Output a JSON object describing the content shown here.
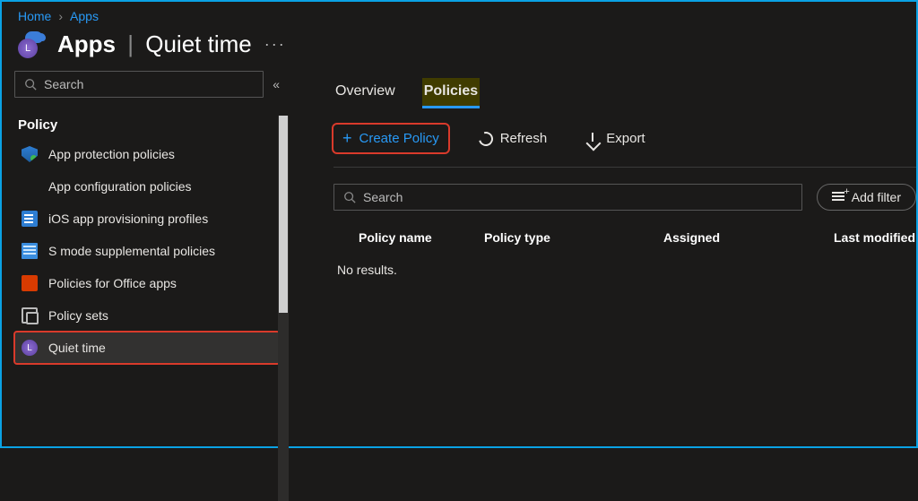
{
  "breadcrumb": {
    "home": "Home",
    "apps": "Apps"
  },
  "header": {
    "title_left": "Apps",
    "title_right": "Quiet time"
  },
  "sidebar": {
    "search_placeholder": "Search",
    "section": "Policy",
    "items": [
      {
        "label": "App protection policies"
      },
      {
        "label": "App configuration policies"
      },
      {
        "label": "iOS app provisioning profiles"
      },
      {
        "label": "S mode supplemental policies"
      },
      {
        "label": "Policies for Office apps"
      },
      {
        "label": "Policy sets"
      },
      {
        "label": "Quiet time"
      }
    ]
  },
  "tabs": {
    "overview": "Overview",
    "policies": "Policies"
  },
  "toolbar": {
    "create": "Create Policy",
    "refresh": "Refresh",
    "export": "Export"
  },
  "filters": {
    "search_placeholder": "Search",
    "add_filter": "Add filter"
  },
  "table": {
    "columns": {
      "name": "Policy name",
      "type": "Policy type",
      "assigned": "Assigned",
      "modified": "Last modified"
    },
    "empty": "No results."
  }
}
